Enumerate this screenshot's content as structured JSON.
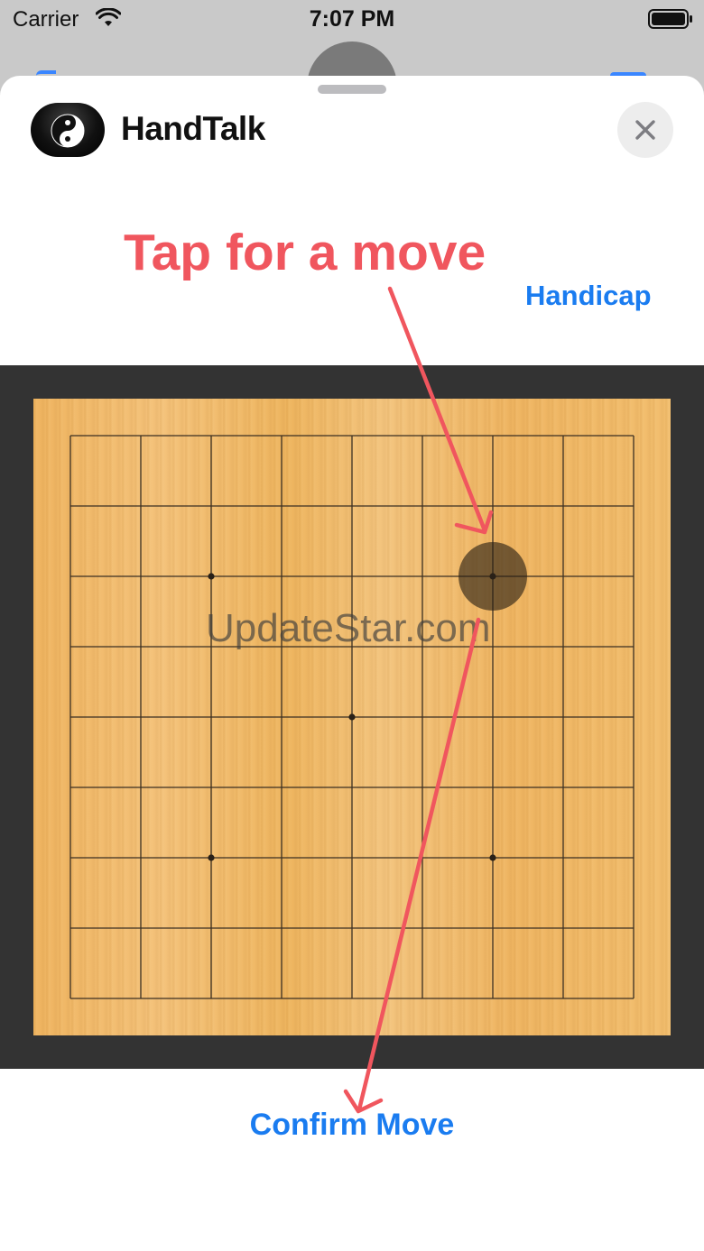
{
  "status_bar": {
    "carrier": "Carrier",
    "time": "7:07 PM"
  },
  "header": {
    "app_title": "HandTalk",
    "app_icon": "yin-yang-icon",
    "close_icon": "close-icon"
  },
  "annotation": {
    "tap_text": "Tap for a move"
  },
  "controls": {
    "handicap_label": "Handicap",
    "confirm_label": "Confirm Move"
  },
  "board": {
    "size": 9,
    "star_points": [
      [
        2,
        2
      ],
      [
        6,
        2
      ],
      [
        4,
        4
      ],
      [
        2,
        6
      ],
      [
        6,
        6
      ]
    ],
    "ghost_stone": {
      "col": 6,
      "row": 2,
      "color": "black"
    }
  },
  "watermark": "UpdateStar.com",
  "colors": {
    "accent": "#1a7cf0",
    "annotation": "#f0565e",
    "board_frame": "#333333"
  }
}
